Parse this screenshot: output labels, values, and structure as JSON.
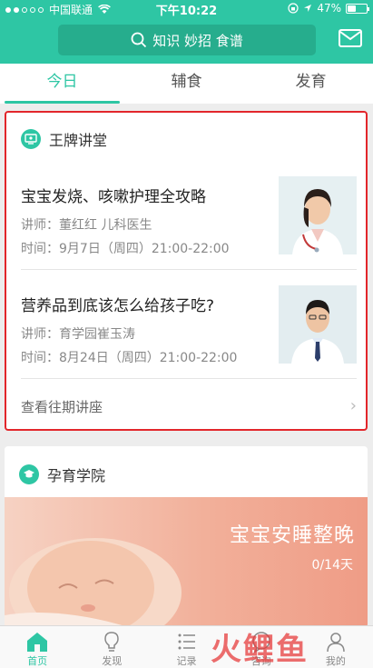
{
  "status_bar": {
    "carrier": "中国联通",
    "time": "下午10:22",
    "battery": "47%"
  },
  "header": {
    "search_text": "知识 妙招 食谱"
  },
  "tabs": [
    {
      "label": "今日"
    },
    {
      "label": "辅食"
    },
    {
      "label": "发育"
    }
  ],
  "lectures_section": {
    "title": "王牌讲堂",
    "items": [
      {
        "title": "宝宝发烧、咳嗽护理全攻略",
        "lecturer": "讲师：董红红 儿科医生",
        "time": "时间：9月7日（周四）21:00-22:00"
      },
      {
        "title": "营养品到底该怎么给孩子吃?",
        "lecturer": "讲师：育学园崔玉涛",
        "time": "时间：8月24日（周四）21:00-22:00"
      }
    ],
    "more_label": "查看往期讲座"
  },
  "academy_section": {
    "title": "孕育学院",
    "banner_title": "宝宝安睡整晚",
    "banner_count": "0/14天"
  },
  "bottom_nav": [
    {
      "label": "首页"
    },
    {
      "label": "发现"
    },
    {
      "label": "记录"
    },
    {
      "label": "咨询"
    },
    {
      "label": "我的"
    }
  ],
  "watermark": "火鲤鱼",
  "colors": {
    "accent": "#2ec6a4",
    "highlight_border": "#e2262b"
  }
}
